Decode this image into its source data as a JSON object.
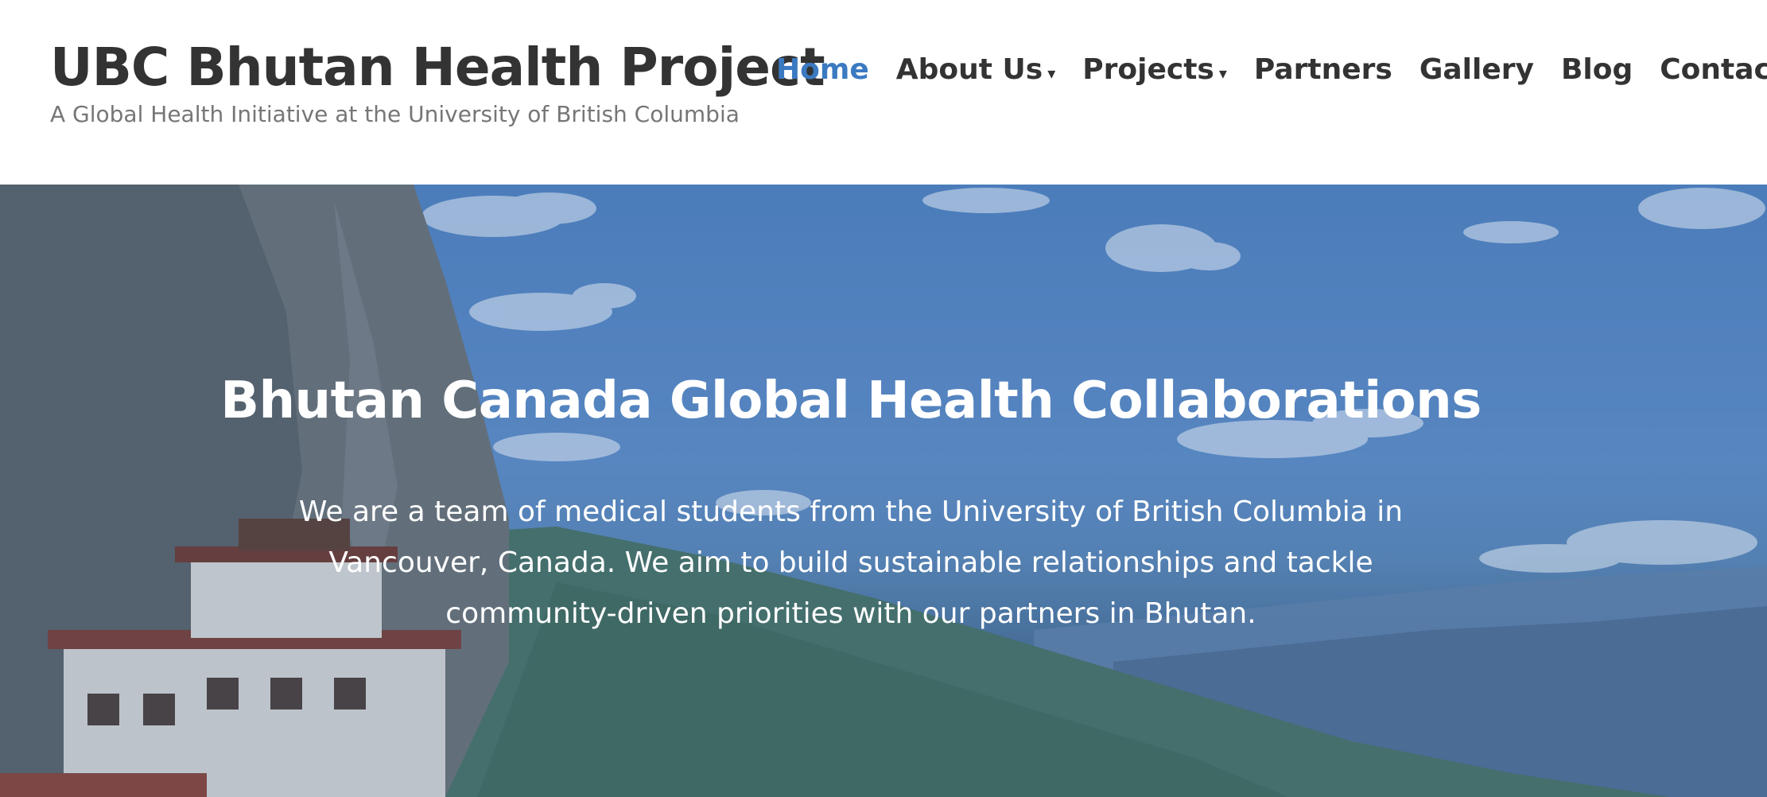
{
  "site": {
    "title": "UBC Bhutan Health Project",
    "tagline": "A Global Health Initiative at the University of British Columbia"
  },
  "nav": {
    "items": [
      {
        "label": "Home",
        "active": true,
        "has_dropdown": false
      },
      {
        "label": "About Us",
        "active": false,
        "has_dropdown": true
      },
      {
        "label": "Projects",
        "active": false,
        "has_dropdown": true
      },
      {
        "label": "Partners",
        "active": false,
        "has_dropdown": false
      },
      {
        "label": "Gallery",
        "active": false,
        "has_dropdown": false
      },
      {
        "label": "Blog",
        "active": false,
        "has_dropdown": false
      },
      {
        "label": "Contact",
        "active": false,
        "has_dropdown": false
      }
    ],
    "dropdown_icon": "▾"
  },
  "hero": {
    "heading": "Bhutan Canada Global Health Collaborations",
    "text": "We are a team of medical students from the University of British Columbia in Vancouver, Canada. We aim to build sustainable relationships and tackle community-driven priorities with our partners in Bhutan."
  },
  "colors": {
    "accent": "#3b7ac1",
    "title_text": "#333333",
    "tagline_text": "#767676",
    "hero_text": "#ffffff"
  }
}
